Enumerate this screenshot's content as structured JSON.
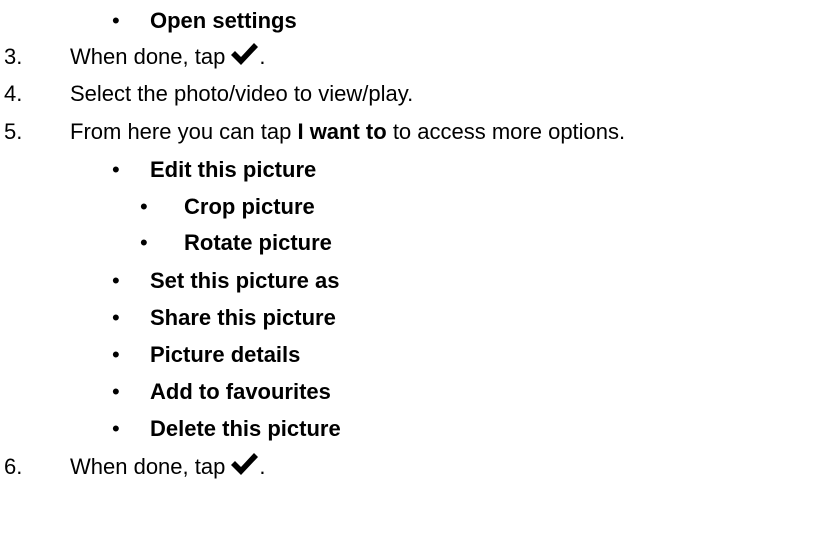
{
  "items": {
    "open_settings": "Open settings",
    "step3_num": "3.",
    "step3_text": "When done, tap",
    "step3_end": ".",
    "step4_num": "4.",
    "step4_text": "Select the photo/video to view/play.",
    "step5_num": "5.",
    "step5_pre": "From here you can tap",
    "step5_bold": "I want to",
    "step5_post": "to access more options.",
    "edit_picture": "Edit this picture",
    "crop_picture": "Crop picture",
    "rotate_picture": "Rotate picture",
    "set_picture_as": "Set this picture as",
    "share_picture": "Share this picture",
    "picture_details": "Picture details",
    "add_favourites": "Add to favourites",
    "delete_picture": "Delete this picture",
    "step6_num": "6.",
    "step6_text": "When done, tap",
    "step6_end": "."
  },
  "bullet_glyph": "•",
  "icons": {
    "confirm": "checkmark-icon"
  }
}
